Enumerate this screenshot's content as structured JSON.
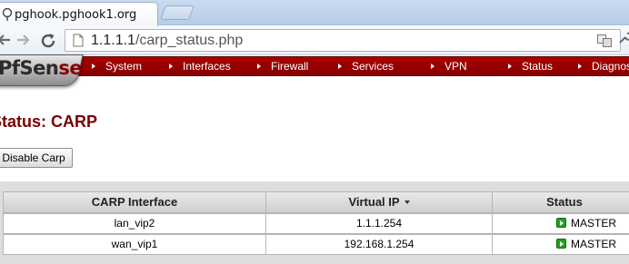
{
  "browser": {
    "tab_title": "pghook.pghook1.org",
    "tab_close": "–",
    "url_host": "1.1.1.1",
    "url_path": "/carp_status.php"
  },
  "logo": {
    "text_main": "PfSen",
    "text_accent": "se"
  },
  "nav": {
    "items": [
      {
        "label": "System"
      },
      {
        "label": "Interfaces"
      },
      {
        "label": "Firewall"
      },
      {
        "label": "Services"
      },
      {
        "label": "VPN"
      },
      {
        "label": "Status"
      },
      {
        "label": "Diagnos"
      }
    ]
  },
  "page": {
    "title": "Status: CARP",
    "disable_button": "Disable Carp"
  },
  "table": {
    "headers": {
      "interface": "CARP Interface",
      "virtual_ip": "Virtual IP",
      "status": "Status"
    },
    "rows": [
      {
        "interface": "lan_vip2",
        "virtual_ip": "1.1.1.254",
        "status": "MASTER"
      },
      {
        "interface": "wan_vip1",
        "virtual_ip": "192.168.1.254",
        "status": "MASTER"
      }
    ]
  },
  "colors": {
    "brand_red": "#a80000",
    "title_red": "#7a0000",
    "status_green": "#1ea21e"
  }
}
